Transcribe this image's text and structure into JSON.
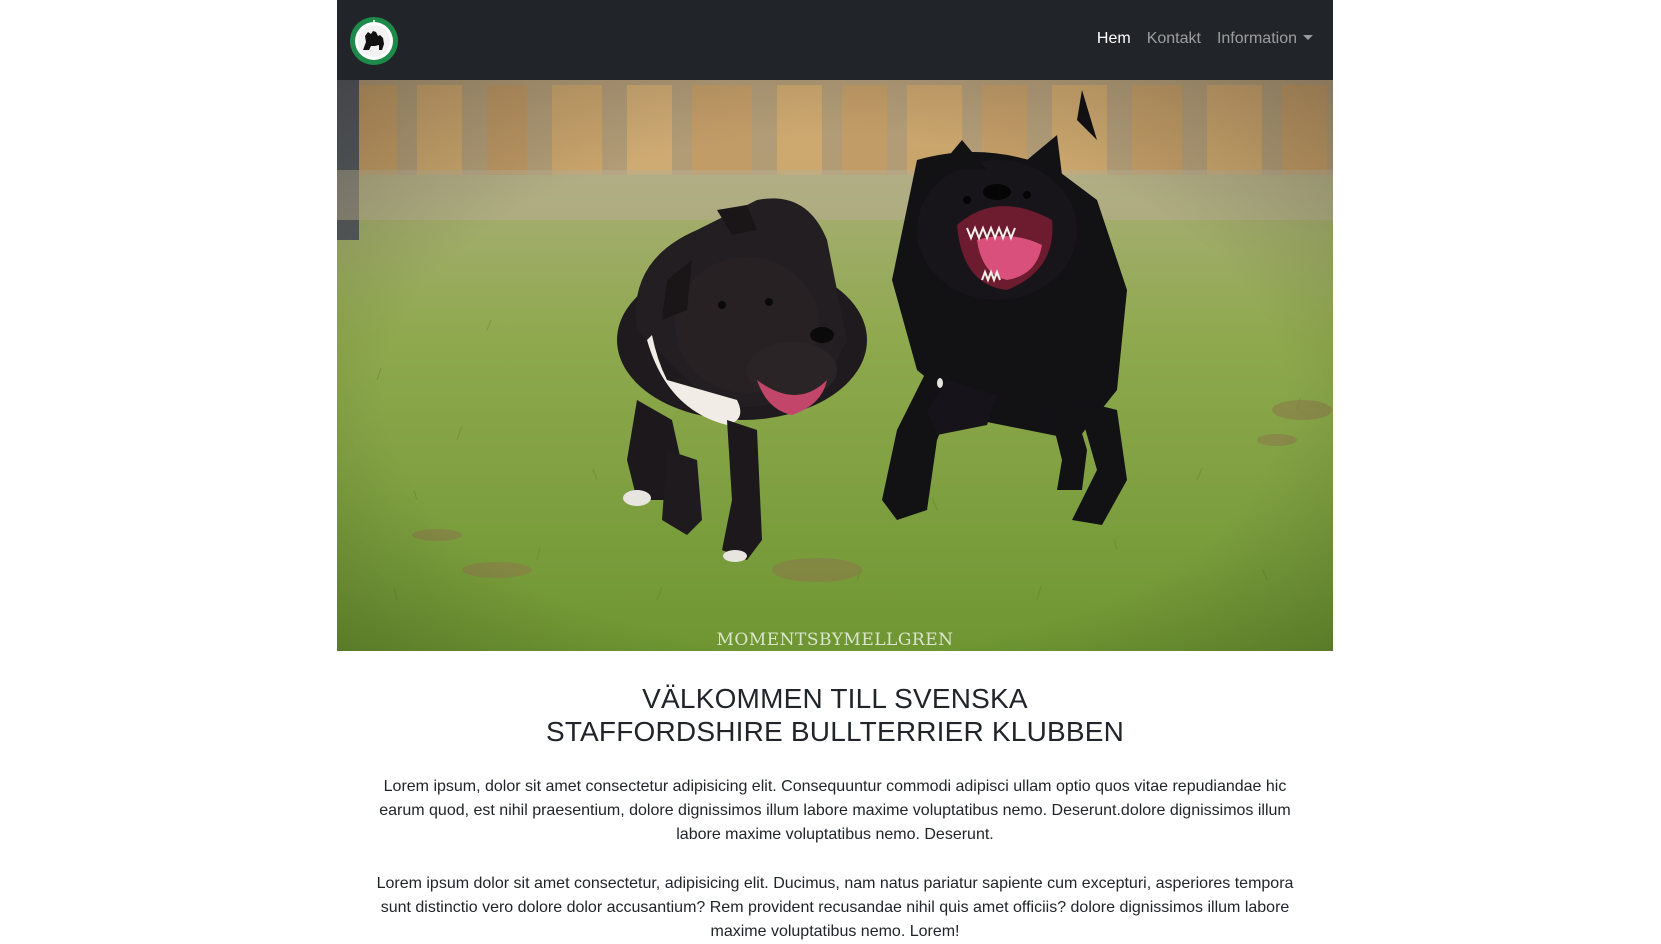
{
  "navbar": {
    "links": [
      {
        "label": "Hem",
        "active": true
      },
      {
        "label": "Kontakt",
        "active": false
      },
      {
        "label": "Information",
        "active": false,
        "dropdown": true
      }
    ],
    "logo_icon": "staffordshire-dog-logo"
  },
  "hero": {
    "watermark": "MOMENTSBYMELLGREN"
  },
  "content": {
    "title_line1": "VÄLKOMMEN TILL SVENSKA",
    "title_line2": "STAFFORDSHIRE BULLTERRIER KLUBBEN",
    "paragraph1": "Lorem ipsum, dolor sit amet consectetur adipisicing elit. Consequuntur commodi adipisci ullam optio quos vitae repudiandae hic earum quod, est nihil praesentium, dolore dignissimos illum labore maxime voluptatibus nemo. Deserunt.dolore dignissimos illum labore maxime voluptatibus nemo. Deserunt.",
    "paragraph2": "Lorem ipsum dolor sit amet consectetur, adipisicing elit. Ducimus, nam natus pariatur sapiente cum excepturi, asperiores tempora sunt distinctio vero dolore dolor accusantium? Rem provident recusandae nihil quis amet officiis? dolore dignissimos illum labore maxime voluptatibus nemo. Lorem!"
  },
  "colors": {
    "navbar_bg": "#212529",
    "logo_green": "#1e8a4a"
  }
}
